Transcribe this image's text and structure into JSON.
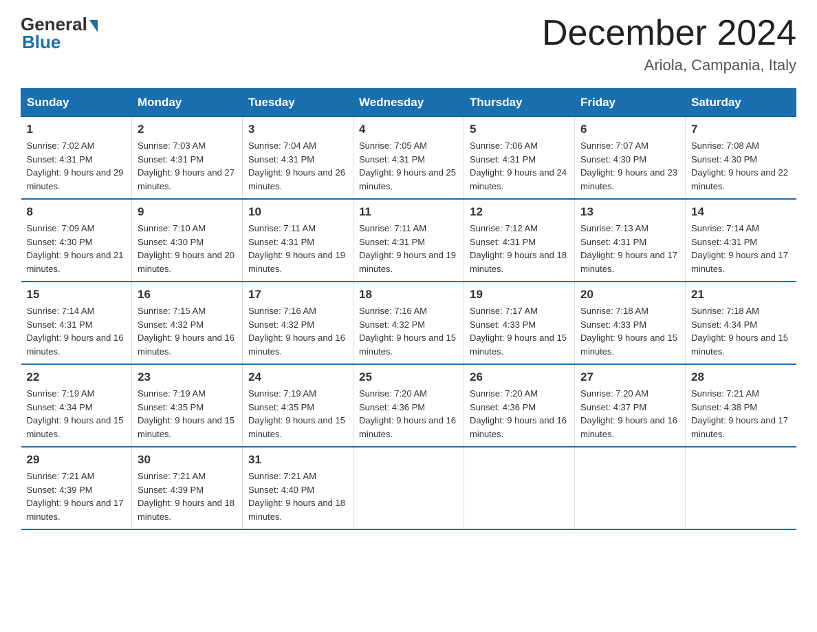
{
  "header": {
    "logo_general": "General",
    "logo_blue": "Blue",
    "title": "December 2024",
    "location": "Ariola, Campania, Italy"
  },
  "days_of_week": [
    "Sunday",
    "Monday",
    "Tuesday",
    "Wednesday",
    "Thursday",
    "Friday",
    "Saturday"
  ],
  "weeks": [
    [
      {
        "day": "1",
        "sunrise": "Sunrise: 7:02 AM",
        "sunset": "Sunset: 4:31 PM",
        "daylight": "Daylight: 9 hours and 29 minutes."
      },
      {
        "day": "2",
        "sunrise": "Sunrise: 7:03 AM",
        "sunset": "Sunset: 4:31 PM",
        "daylight": "Daylight: 9 hours and 27 minutes."
      },
      {
        "day": "3",
        "sunrise": "Sunrise: 7:04 AM",
        "sunset": "Sunset: 4:31 PM",
        "daylight": "Daylight: 9 hours and 26 minutes."
      },
      {
        "day": "4",
        "sunrise": "Sunrise: 7:05 AM",
        "sunset": "Sunset: 4:31 PM",
        "daylight": "Daylight: 9 hours and 25 minutes."
      },
      {
        "day": "5",
        "sunrise": "Sunrise: 7:06 AM",
        "sunset": "Sunset: 4:31 PM",
        "daylight": "Daylight: 9 hours and 24 minutes."
      },
      {
        "day": "6",
        "sunrise": "Sunrise: 7:07 AM",
        "sunset": "Sunset: 4:30 PM",
        "daylight": "Daylight: 9 hours and 23 minutes."
      },
      {
        "day": "7",
        "sunrise": "Sunrise: 7:08 AM",
        "sunset": "Sunset: 4:30 PM",
        "daylight": "Daylight: 9 hours and 22 minutes."
      }
    ],
    [
      {
        "day": "8",
        "sunrise": "Sunrise: 7:09 AM",
        "sunset": "Sunset: 4:30 PM",
        "daylight": "Daylight: 9 hours and 21 minutes."
      },
      {
        "day": "9",
        "sunrise": "Sunrise: 7:10 AM",
        "sunset": "Sunset: 4:30 PM",
        "daylight": "Daylight: 9 hours and 20 minutes."
      },
      {
        "day": "10",
        "sunrise": "Sunrise: 7:11 AM",
        "sunset": "Sunset: 4:31 PM",
        "daylight": "Daylight: 9 hours and 19 minutes."
      },
      {
        "day": "11",
        "sunrise": "Sunrise: 7:11 AM",
        "sunset": "Sunset: 4:31 PM",
        "daylight": "Daylight: 9 hours and 19 minutes."
      },
      {
        "day": "12",
        "sunrise": "Sunrise: 7:12 AM",
        "sunset": "Sunset: 4:31 PM",
        "daylight": "Daylight: 9 hours and 18 minutes."
      },
      {
        "day": "13",
        "sunrise": "Sunrise: 7:13 AM",
        "sunset": "Sunset: 4:31 PM",
        "daylight": "Daylight: 9 hours and 17 minutes."
      },
      {
        "day": "14",
        "sunrise": "Sunrise: 7:14 AM",
        "sunset": "Sunset: 4:31 PM",
        "daylight": "Daylight: 9 hours and 17 minutes."
      }
    ],
    [
      {
        "day": "15",
        "sunrise": "Sunrise: 7:14 AM",
        "sunset": "Sunset: 4:31 PM",
        "daylight": "Daylight: 9 hours and 16 minutes."
      },
      {
        "day": "16",
        "sunrise": "Sunrise: 7:15 AM",
        "sunset": "Sunset: 4:32 PM",
        "daylight": "Daylight: 9 hours and 16 minutes."
      },
      {
        "day": "17",
        "sunrise": "Sunrise: 7:16 AM",
        "sunset": "Sunset: 4:32 PM",
        "daylight": "Daylight: 9 hours and 16 minutes."
      },
      {
        "day": "18",
        "sunrise": "Sunrise: 7:16 AM",
        "sunset": "Sunset: 4:32 PM",
        "daylight": "Daylight: 9 hours and 15 minutes."
      },
      {
        "day": "19",
        "sunrise": "Sunrise: 7:17 AM",
        "sunset": "Sunset: 4:33 PM",
        "daylight": "Daylight: 9 hours and 15 minutes."
      },
      {
        "day": "20",
        "sunrise": "Sunrise: 7:18 AM",
        "sunset": "Sunset: 4:33 PM",
        "daylight": "Daylight: 9 hours and 15 minutes."
      },
      {
        "day": "21",
        "sunrise": "Sunrise: 7:18 AM",
        "sunset": "Sunset: 4:34 PM",
        "daylight": "Daylight: 9 hours and 15 minutes."
      }
    ],
    [
      {
        "day": "22",
        "sunrise": "Sunrise: 7:19 AM",
        "sunset": "Sunset: 4:34 PM",
        "daylight": "Daylight: 9 hours and 15 minutes."
      },
      {
        "day": "23",
        "sunrise": "Sunrise: 7:19 AM",
        "sunset": "Sunset: 4:35 PM",
        "daylight": "Daylight: 9 hours and 15 minutes."
      },
      {
        "day": "24",
        "sunrise": "Sunrise: 7:19 AM",
        "sunset": "Sunset: 4:35 PM",
        "daylight": "Daylight: 9 hours and 15 minutes."
      },
      {
        "day": "25",
        "sunrise": "Sunrise: 7:20 AM",
        "sunset": "Sunset: 4:36 PM",
        "daylight": "Daylight: 9 hours and 16 minutes."
      },
      {
        "day": "26",
        "sunrise": "Sunrise: 7:20 AM",
        "sunset": "Sunset: 4:36 PM",
        "daylight": "Daylight: 9 hours and 16 minutes."
      },
      {
        "day": "27",
        "sunrise": "Sunrise: 7:20 AM",
        "sunset": "Sunset: 4:37 PM",
        "daylight": "Daylight: 9 hours and 16 minutes."
      },
      {
        "day": "28",
        "sunrise": "Sunrise: 7:21 AM",
        "sunset": "Sunset: 4:38 PM",
        "daylight": "Daylight: 9 hours and 17 minutes."
      }
    ],
    [
      {
        "day": "29",
        "sunrise": "Sunrise: 7:21 AM",
        "sunset": "Sunset: 4:39 PM",
        "daylight": "Daylight: 9 hours and 17 minutes."
      },
      {
        "day": "30",
        "sunrise": "Sunrise: 7:21 AM",
        "sunset": "Sunset: 4:39 PM",
        "daylight": "Daylight: 9 hours and 18 minutes."
      },
      {
        "day": "31",
        "sunrise": "Sunrise: 7:21 AM",
        "sunset": "Sunset: 4:40 PM",
        "daylight": "Daylight: 9 hours and 18 minutes."
      },
      null,
      null,
      null,
      null
    ]
  ]
}
